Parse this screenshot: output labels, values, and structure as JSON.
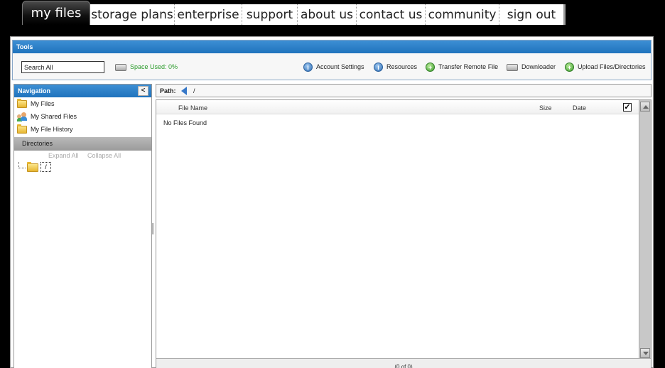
{
  "topnav": {
    "tabs": [
      {
        "label": "my files",
        "active": true
      },
      {
        "label": "storage plans"
      },
      {
        "label": "enterprise"
      },
      {
        "label": "support"
      },
      {
        "label": "about us"
      },
      {
        "label": "contact us"
      },
      {
        "label": "community"
      },
      {
        "label": "sign out"
      }
    ]
  },
  "tools": {
    "title": "Tools",
    "search_value": "Search All",
    "space_used": "Space Used: 0%",
    "actions": [
      {
        "label": "Account Settings",
        "icon": "info-icon"
      },
      {
        "label": "Resources",
        "icon": "info-icon"
      },
      {
        "label": "Transfer Remote File",
        "icon": "plus-icon"
      },
      {
        "label": "Downloader",
        "icon": "drive-icon"
      },
      {
        "label": "Upload Files/Directories",
        "icon": "plus-icon"
      }
    ]
  },
  "navigation": {
    "title": "Navigation",
    "collapse_glyph": "<",
    "links": [
      {
        "label": "My Files",
        "icon": "folder-icon"
      },
      {
        "label": "My Shared Files",
        "icon": "users-icon"
      },
      {
        "label": "My File History",
        "icon": "folder-icon"
      }
    ],
    "directories_title": "Directories",
    "expand_all": "Expand All",
    "collapse_all": "Collapse All",
    "tree_root": "/"
  },
  "path": {
    "label": "Path:",
    "value": "/"
  },
  "grid": {
    "columns": {
      "name": "File Name",
      "size": "Size",
      "date": "Date"
    },
    "select_all_mark": "✓",
    "empty_message": "No Files Found",
    "footer": "(0 of 0)"
  },
  "colors": {
    "panel_header": "#1f73bd",
    "space_used": "#2b9b2b"
  }
}
